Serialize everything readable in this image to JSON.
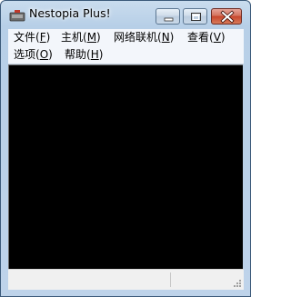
{
  "window": {
    "title": "Nestopia Plus!",
    "icon": "nes-console-icon",
    "controls": [
      "minimize-icon",
      "maximize-icon",
      "close-icon"
    ]
  },
  "menubar": {
    "items": [
      {
        "label": "文件(F)",
        "accel": "F"
      },
      {
        "label": "主机(M)",
        "accel": "M"
      },
      {
        "label": "网络联机(N)",
        "accel": "N"
      },
      {
        "label": "查看(V)",
        "accel": "V"
      },
      {
        "label": "选项(O)",
        "accel": "O"
      },
      {
        "label": "帮助(H)",
        "accel": "H"
      }
    ]
  },
  "colors": {
    "screen": "#000000",
    "frame": "#bcd2ea",
    "menubar": "#f3f6fb",
    "close_button": "#c7462b"
  },
  "statusbar": {
    "left_text": "",
    "right_text": ""
  }
}
